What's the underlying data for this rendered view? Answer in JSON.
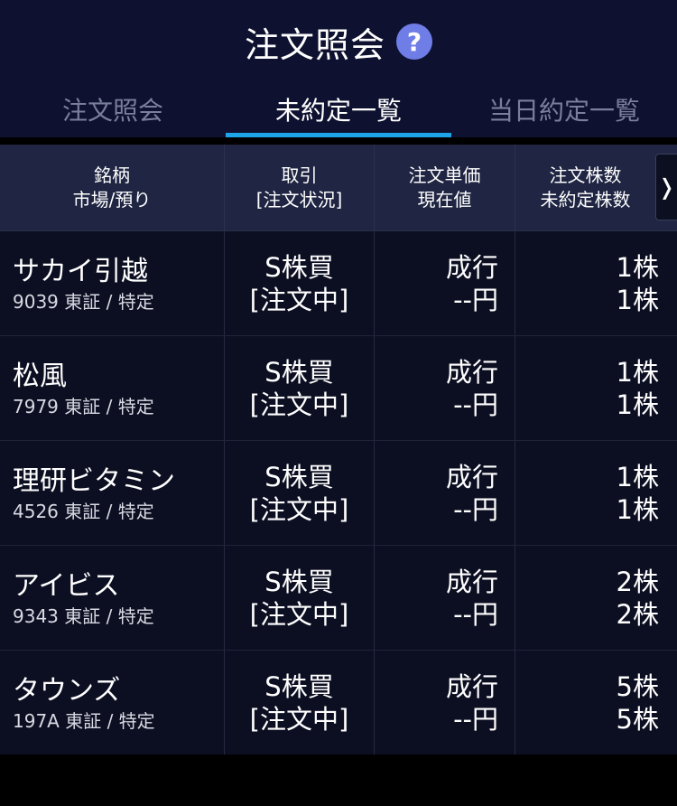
{
  "header": {
    "title": "注文照会",
    "help_icon": "question-circle-icon"
  },
  "tabs": [
    {
      "label": "注文照会",
      "active": false
    },
    {
      "label": "未約定一覧",
      "active": true
    },
    {
      "label": "当日約定一覧",
      "active": false
    }
  ],
  "table": {
    "columns": [
      {
        "line1": "銘柄",
        "line2": "市場/預り"
      },
      {
        "line1": "取引",
        "line2": "[注文状況]"
      },
      {
        "line1": "注文単価",
        "line2": "現在値"
      },
      {
        "line1": "注文株数",
        "line2": "未約定株数"
      }
    ],
    "scroll_arrow": "❭",
    "rows": [
      {
        "name": "サカイ引越",
        "sub": "9039 東証 / 特定",
        "trade": "S株買",
        "status": "[注文中]",
        "price": "成行",
        "current": "--円",
        "qty": "1株",
        "unfilled": "1株"
      },
      {
        "name": "松風",
        "sub": "7979 東証 / 特定",
        "trade": "S株買",
        "status": "[注文中]",
        "price": "成行",
        "current": "--円",
        "qty": "1株",
        "unfilled": "1株"
      },
      {
        "name": "理研ビタミン",
        "sub": "4526 東証 / 特定",
        "trade": "S株買",
        "status": "[注文中]",
        "price": "成行",
        "current": "--円",
        "qty": "1株",
        "unfilled": "1株"
      },
      {
        "name": "アイビス",
        "sub": "9343 東証 / 特定",
        "trade": "S株買",
        "status": "[注文中]",
        "price": "成行",
        "current": "--円",
        "qty": "2株",
        "unfilled": "2株"
      },
      {
        "name": "タウンズ",
        "sub": "197A 東証 / 特定",
        "trade": "S株買",
        "status": "[注文中]",
        "price": "成行",
        "current": "--円",
        "qty": "5株",
        "unfilled": "5株"
      }
    ]
  },
  "colors": {
    "header_bg": "#0e1230",
    "accent": "#1ea5e9",
    "help_icon_bg": "#6f7de6",
    "table_header_bg": "#1f2542",
    "row_bg": "#0c0f22"
  }
}
